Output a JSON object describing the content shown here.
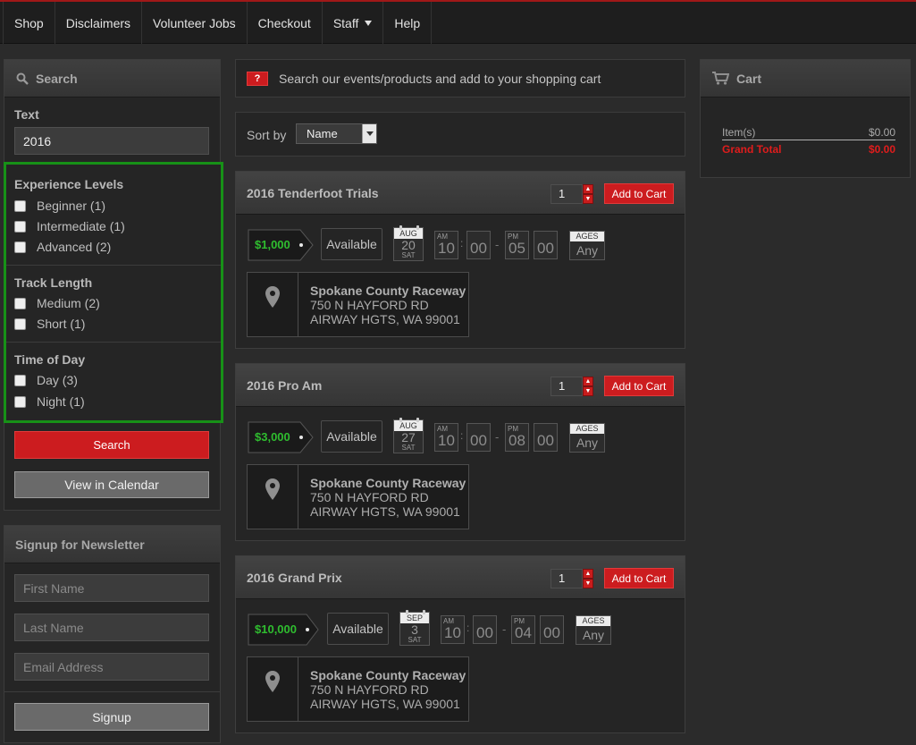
{
  "nav": {
    "items": [
      "Shop",
      "Disclaimers",
      "Volunteer Jobs",
      "Checkout",
      "Staff",
      "Help"
    ]
  },
  "search_panel": {
    "title": "Search",
    "text_label": "Text",
    "text_value": "2016",
    "groups": [
      {
        "title": "Experience Levels",
        "items": [
          "Beginner (1)",
          "Intermediate (1)",
          "Advanced (2)"
        ]
      },
      {
        "title": "Track Length",
        "items": [
          "Medium (2)",
          "Short (1)"
        ]
      },
      {
        "title": "Time of Day",
        "items": [
          "Day (3)",
          "Night (1)"
        ]
      }
    ],
    "search_button": "Search",
    "calendar_button": "View in Calendar"
  },
  "newsletter": {
    "title": "Signup for Newsletter",
    "first_name_placeholder": "First Name",
    "last_name_placeholder": "Last Name",
    "email_placeholder": "Email Address",
    "signup_button": "Signup"
  },
  "info_bar": {
    "help_glyph": "?",
    "text": "Search our events/products and add to your shopping cart"
  },
  "sort": {
    "label": "Sort by",
    "selected": "Name"
  },
  "events": [
    {
      "title": "2016 Tenderfoot Trials",
      "qty": "1",
      "add_label": "Add to Cart",
      "price": "$1,000",
      "status": "Available",
      "month": "AUG",
      "day": "20",
      "dow": "SAT",
      "start_ampm": "AM",
      "start_hour": "10",
      "start_min": "00",
      "end_ampm": "PM",
      "end_hour": "05",
      "end_min": "00",
      "ages_label": "AGES",
      "ages": "Any",
      "venue_name": "Spokane County Raceway",
      "venue_addr1": "750 N HAYFORD RD",
      "venue_addr2": "AIRWAY HGTS, WA 99001"
    },
    {
      "title": "2016 Pro Am",
      "qty": "1",
      "add_label": "Add to Cart",
      "price": "$3,000",
      "status": "Available",
      "month": "AUG",
      "day": "27",
      "dow": "SAT",
      "start_ampm": "AM",
      "start_hour": "10",
      "start_min": "00",
      "end_ampm": "PM",
      "end_hour": "08",
      "end_min": "00",
      "ages_label": "AGES",
      "ages": "Any",
      "venue_name": "Spokane County Raceway",
      "venue_addr1": "750 N HAYFORD RD",
      "venue_addr2": "AIRWAY HGTS, WA 99001"
    },
    {
      "title": "2016 Grand Prix",
      "qty": "1",
      "add_label": "Add to Cart",
      "price": "$10,000",
      "status": "Available",
      "month": "SEP",
      "day": "3",
      "dow": "SAT",
      "start_ampm": "AM",
      "start_hour": "10",
      "start_min": "00",
      "end_ampm": "PM",
      "end_hour": "04",
      "end_min": "00",
      "ages_label": "AGES",
      "ages": "Any",
      "venue_name": "Spokane County Raceway",
      "venue_addr1": "750 N HAYFORD RD",
      "venue_addr2": "AIRWAY HGTS, WA 99001"
    }
  ],
  "cart": {
    "title": "Cart",
    "items_label": "Item(s)",
    "items_value": "$0.00",
    "total_label": "Grand Total",
    "total_value": "$0.00"
  },
  "colors": {
    "accent_red": "#cc1c1f",
    "price_green": "#2fbd2f",
    "filter_highlight": "#179117"
  },
  "icons": [
    "search-icon",
    "help-icon",
    "cart-icon",
    "map-pin-icon",
    "chevron-down-icon",
    "price-tag-icon",
    "calendar-icon"
  ]
}
